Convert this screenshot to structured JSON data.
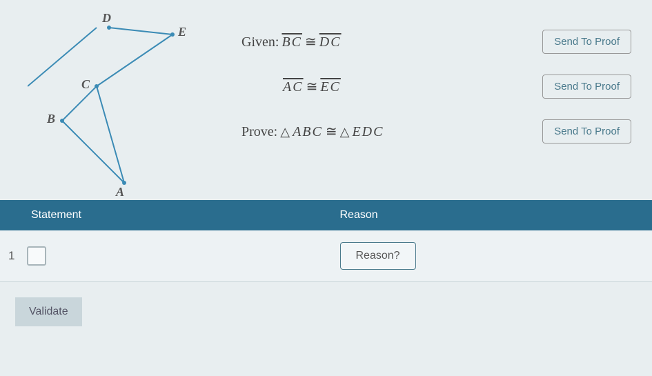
{
  "figure": {
    "labels": {
      "A": "A",
      "B": "B",
      "C": "C",
      "D": "D",
      "E": "E"
    }
  },
  "statements": {
    "given_label": "Given:",
    "line1": {
      "seg1": "BC",
      "rel": "≅",
      "seg2": "DC"
    },
    "line2": {
      "seg1": "AC",
      "rel": "≅",
      "seg2": "EC"
    },
    "prove_label": "Prove:",
    "line3": {
      "tri1": "ABC",
      "rel": "≅",
      "tri2": "EDC"
    },
    "send_button": "Send To Proof"
  },
  "table": {
    "header_statement": "Statement",
    "header_reason": "Reason",
    "rows": [
      {
        "number": "1",
        "reason_button": "Reason?"
      }
    ]
  },
  "validate_button": "Validate"
}
